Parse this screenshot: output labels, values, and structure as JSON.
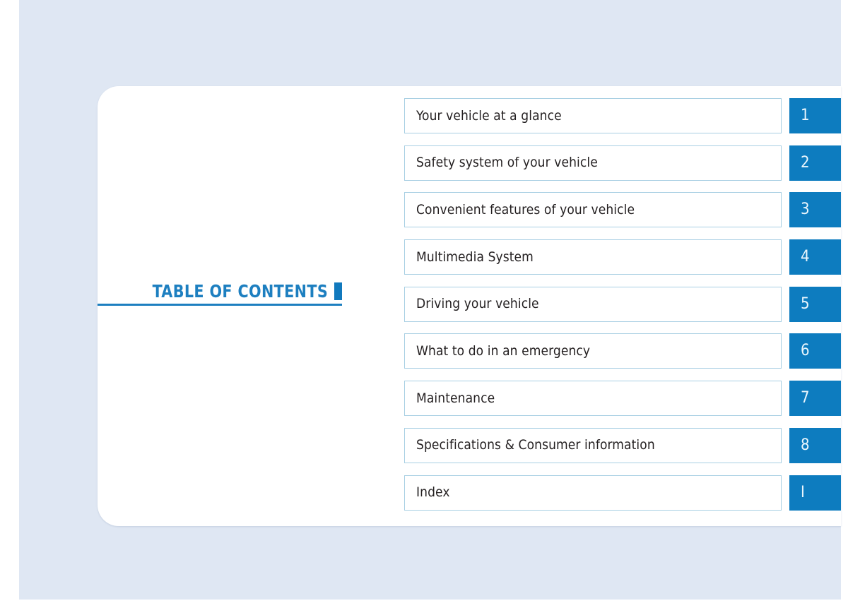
{
  "page": {
    "background_color": "#dfe7f3",
    "card_color": "#ffffff",
    "accent_color": "#0d7cbf",
    "title_color": "#1d7fc0",
    "row_border_color": "#a8cfe3",
    "text_color": "#231f20"
  },
  "toc": {
    "title": "TABLE OF CONTENTS",
    "entries": [
      {
        "label": "Your vehicle at a glance",
        "number": "1"
      },
      {
        "label": "Safety system of your vehicle",
        "number": "2"
      },
      {
        "label": "Convenient features of your vehicle",
        "number": "3"
      },
      {
        "label": "Multimedia System",
        "number": "4"
      },
      {
        "label": "Driving your vehicle",
        "number": "5"
      },
      {
        "label": "What to do in an emergency",
        "number": "6"
      },
      {
        "label": "Maintenance",
        "number": "7"
      },
      {
        "label": "Specifications & Consumer information",
        "number": "8"
      },
      {
        "label": "Index",
        "number": "I"
      }
    ]
  }
}
